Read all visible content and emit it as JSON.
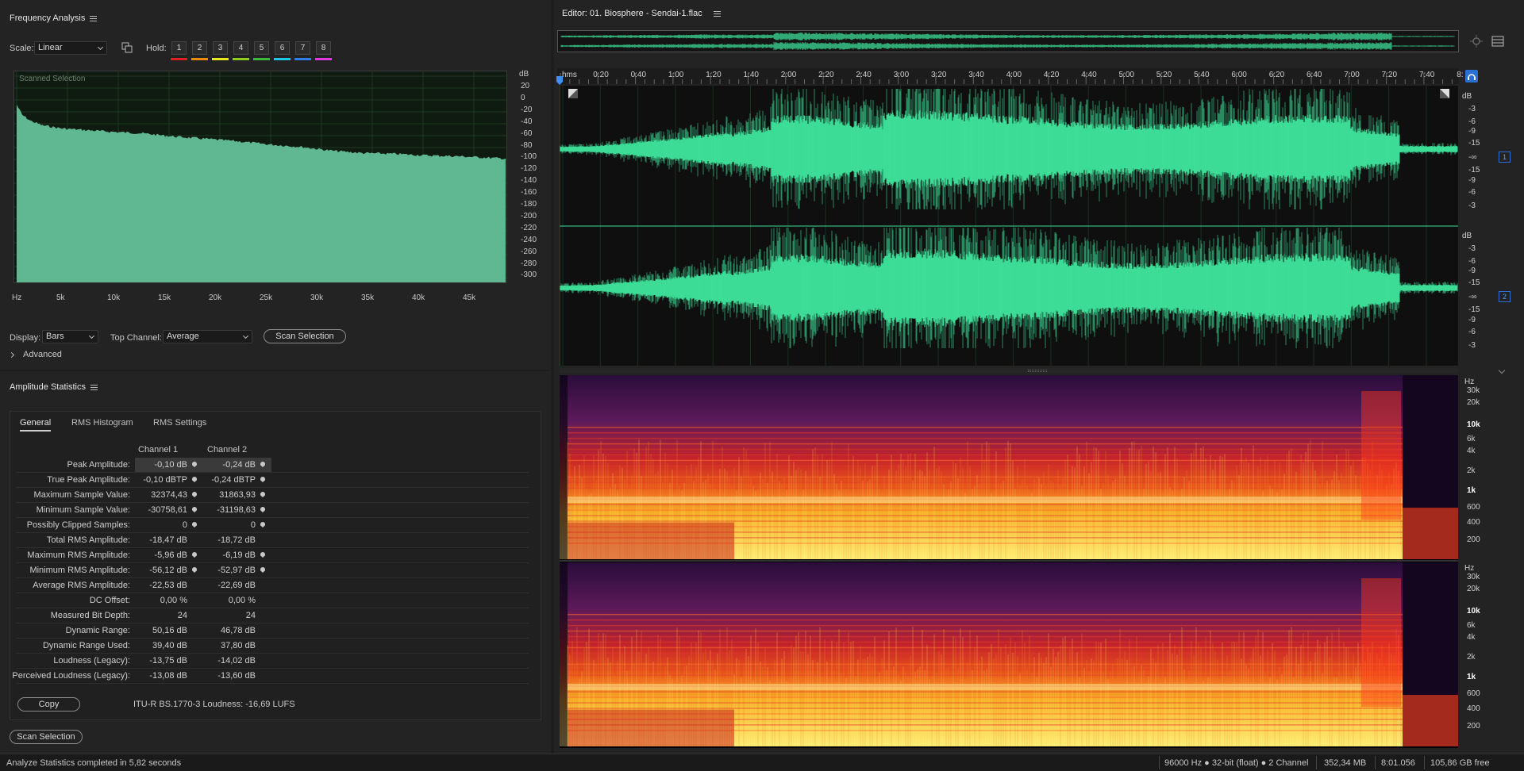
{
  "freq_panel": {
    "title": "Frequency Analysis",
    "scale_label": "Scale:",
    "scale_value": "Linear",
    "hold_label": "Hold:",
    "hold_buttons": [
      "1",
      "2",
      "3",
      "4",
      "5",
      "6",
      "7",
      "8"
    ],
    "hold_colors": [
      "#e02020",
      "#ee8a10",
      "#e9e91a",
      "#8ccc1a",
      "#3cb83c",
      "#20c8e8",
      "#2e80e8",
      "#e03ae0"
    ],
    "plot_caption": "Scanned Selection",
    "y_axis_unit": "dB",
    "y_ticks": [
      "20",
      "0",
      "-20",
      "-40",
      "-60",
      "-80",
      "-100",
      "-120",
      "-140",
      "-160",
      "-180",
      "-200",
      "-220",
      "-240",
      "-260",
      "-280",
      "-300"
    ],
    "x_ticks": [
      "Hz",
      "5k",
      "10k",
      "15k",
      "20k",
      "25k",
      "30k",
      "35k",
      "40k",
      "45k"
    ],
    "display_label": "Display:",
    "display_value": "Bars",
    "top_channel_label": "Top Channel:",
    "top_channel_value": "Average",
    "scan_button": "Scan Selection",
    "advanced_label": "Advanced",
    "fill_color": "#5fb892"
  },
  "amp_panel": {
    "title": "Amplitude Statistics",
    "tabs": [
      "General",
      "RMS Histogram",
      "RMS Settings"
    ],
    "col1": "Channel 1",
    "col2": "Channel 2",
    "rows": [
      {
        "label": "Peak Amplitude:",
        "c1": "-0,10 dB",
        "c2": "-0,24 dB"
      },
      {
        "label": "True Peak Amplitude:",
        "c1": "-0,10 dBTP",
        "c2": "-0,24 dBTP"
      },
      {
        "label": "Maximum Sample Value:",
        "c1": "32374,43",
        "c2": "31863,93"
      },
      {
        "label": "Minimum Sample Value:",
        "c1": "-30758,61",
        "c2": "-31198,63"
      },
      {
        "label": "Possibly Clipped Samples:",
        "c1": "0",
        "c2": "0"
      },
      {
        "label": "Total RMS Amplitude:",
        "c1": "-18,47 dB",
        "c2": "-18,72 dB"
      },
      {
        "label": "Maximum RMS Amplitude:",
        "c1": "-5,96 dB",
        "c2": "-6,19 dB"
      },
      {
        "label": "Minimum RMS Amplitude:",
        "c1": "-56,12 dB",
        "c2": "-52,97 dB"
      },
      {
        "label": "Average RMS Amplitude:",
        "c1": "-22,53 dB",
        "c2": "-22,69 dB"
      },
      {
        "label": "DC Offset:",
        "c1": "0,00 %",
        "c2": "0,00 %"
      },
      {
        "label": "Measured Bit Depth:",
        "c1": "24",
        "c2": "24"
      },
      {
        "label": "Dynamic Range:",
        "c1": "50,16 dB",
        "c2": "46,78 dB"
      },
      {
        "label": "Dynamic Range Used:",
        "c1": "39,40 dB",
        "c2": "37,80 dB"
      },
      {
        "label": "Loudness (Legacy):",
        "c1": "-13,75 dB",
        "c2": "-14,02 dB"
      },
      {
        "label": "Perceived Loudness (Legacy):",
        "c1": "-13,08 dB",
        "c2": "-13,60 dB"
      }
    ],
    "copy_button": "Copy",
    "loudness_text": "ITU-R BS.1770-3 Loudness: -16,69 LUFS",
    "scan_button": "Scan Selection"
  },
  "editor": {
    "title": "Editor: 01. Biosphere - Sendai-1.flac",
    "ruler_ticks": [
      "hms",
      "0:20",
      "0:40",
      "1:00",
      "1:20",
      "1:40",
      "2:00",
      "2:20",
      "2:40",
      "3:00",
      "3:20",
      "3:40",
      "4:00",
      "4:20",
      "4:40",
      "5:00",
      "5:20",
      "5:40",
      "6:00",
      "6:20",
      "6:40",
      "7:00",
      "7:20",
      "7:40",
      "8:"
    ],
    "db_scale": [
      "dB",
      "-3",
      "-6",
      "-9",
      "-15",
      "-∞",
      "-15",
      "-9",
      "-6",
      "-3"
    ],
    "channel_badges": [
      "1",
      "2"
    ],
    "hz_scale": [
      "Hz",
      "30k",
      "20k",
      "10k",
      "6k",
      "4k",
      "2k",
      "1k",
      "600",
      "400",
      "200"
    ],
    "wave_color": "#3ddc97"
  },
  "status_bar": {
    "message": "Analyze Statistics completed in 5,82 seconds",
    "sample_info": "96000 Hz ● 32-bit (float) ● 2 Channel",
    "size": "352,34 MB",
    "duration": "8:01.056",
    "free": "105,86 GB free"
  }
}
